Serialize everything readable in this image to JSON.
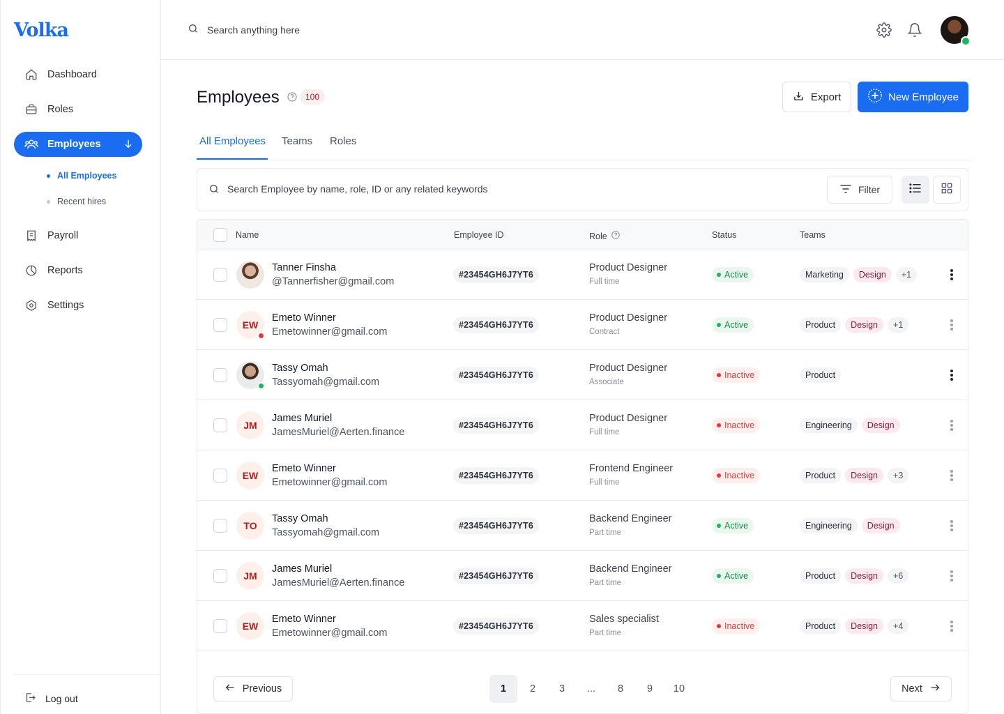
{
  "app": {
    "logo": "Volka",
    "accent": "#1a6cf0"
  },
  "sidebar": {
    "items": [
      {
        "label": "Dashboard",
        "icon": "home-icon"
      },
      {
        "label": "Roles",
        "icon": "briefcase-icon"
      },
      {
        "label": "Employees",
        "icon": "users-icon"
      },
      {
        "label": "Payroll",
        "icon": "receipt-icon"
      },
      {
        "label": "Reports",
        "icon": "pie-chart-icon"
      },
      {
        "label": "Settings",
        "icon": "settings-hex-icon"
      }
    ],
    "subitems": [
      {
        "label": "All Employees"
      },
      {
        "label": "Recent hires"
      }
    ],
    "logout": "Log out"
  },
  "topbar": {
    "search_placeholder": "Search anything here"
  },
  "page": {
    "title": "Employees",
    "count": "100",
    "export_label": "Export",
    "new_label": "New Employee"
  },
  "tabs": [
    "All Employees",
    "Teams",
    "Roles"
  ],
  "table_search": {
    "placeholder": "Search Employee by name, role, ID or any related keywords",
    "filter_label": "Filter"
  },
  "table": {
    "headers": {
      "name": "Name",
      "id": "Employee ID",
      "role": "Role",
      "status": "Status",
      "teams": "Teams"
    },
    "rows": [
      {
        "name": "Tanner Finsha",
        "email": "@Tannerfisher@gmail.com",
        "initials": "",
        "id": "#23454GH6J7YT6",
        "role": "Product Designer",
        "type": "Full time",
        "status": "Active",
        "teams": [
          "Marketing",
          "Design",
          "+1"
        ]
      },
      {
        "name": "Emeto  Winner",
        "email": "Emetowinner@gmail.com",
        "initials": "EW",
        "id": "#23454GH6J7YT6",
        "role": "Product Designer",
        "type": "Contract",
        "status": "Active",
        "teams": [
          "Product",
          "Design",
          "+1"
        ]
      },
      {
        "name": "Tassy Omah",
        "email": "Tassyomah@gmail.com",
        "initials": "",
        "id": "#23454GH6J7YT6",
        "role": "Product Designer",
        "type": "Associate",
        "status": "Inactive",
        "teams": [
          "Product"
        ]
      },
      {
        "name": "James Muriel",
        "email": "JamesMuriel@Aerten.finance",
        "initials": "JM",
        "id": "#23454GH6J7YT6",
        "role": "Product Designer",
        "type": "Full time",
        "status": "Inactive",
        "teams": [
          "Engineering",
          "Design"
        ]
      },
      {
        "name": "Emeto  Winner",
        "email": "Emetowinner@gmail.com",
        "initials": "EW",
        "id": "#23454GH6J7YT6",
        "role": "Frontend Engineer",
        "type": "Full time",
        "status": "Inactive",
        "teams": [
          "Product",
          "Design",
          "+3"
        ]
      },
      {
        "name": "Tassy Omah",
        "email": "Tassyomah@gmail.com",
        "initials": "TO",
        "id": "#23454GH6J7YT6",
        "role": "Backend Engineer",
        "type": "Part time",
        "status": "Active",
        "teams": [
          "Engineering",
          "Design"
        ]
      },
      {
        "name": "James Muriel",
        "email": "JamesMuriel@Aerten.finance",
        "initials": "JM",
        "id": "#23454GH6J7YT6",
        "role": "Backend Engineer",
        "type": "Part time",
        "status": "Active",
        "teams": [
          "Product",
          "Design",
          "+6"
        ]
      },
      {
        "name": "Emeto  Winner",
        "email": "Emetowinner@gmail.com",
        "initials": "EW",
        "id": "#23454GH6J7YT6",
        "role": "Sales specialist",
        "type": "Part time",
        "status": "Inactive",
        "teams": [
          "Product",
          "Design",
          "+4"
        ]
      }
    ]
  },
  "pagination": {
    "previous": "Previous",
    "next": "Next",
    "pages": [
      "1",
      "2",
      "3",
      "...",
      "8",
      "9",
      "10"
    ],
    "current": "1"
  }
}
